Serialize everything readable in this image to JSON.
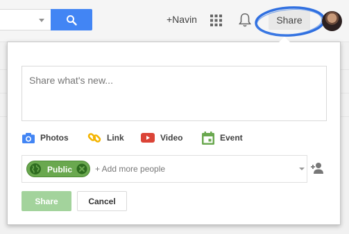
{
  "header": {
    "plus_name": "+Navin",
    "share_label": "Share"
  },
  "composer": {
    "placeholder": "Share what's new...",
    "media": [
      {
        "label": "Photos",
        "icon": "camera-icon",
        "color": "#4285f4"
      },
      {
        "label": "Link",
        "icon": "link-icon",
        "color": "#f4b400"
      },
      {
        "label": "Video",
        "icon": "video-icon",
        "color": "#db4437"
      },
      {
        "label": "Event",
        "icon": "calendar-icon",
        "color": "#6aa84f"
      }
    ],
    "audience": {
      "chip_label": "Public",
      "add_more_placeholder": "+ Add more people"
    },
    "share_label": "Share",
    "cancel_label": "Cancel"
  },
  "colors": {
    "search_blue": "#4285f4",
    "highlight_ring": "#2f6fe0",
    "public_green": "#6aa84f",
    "share_disabled": "#a3d39c"
  }
}
